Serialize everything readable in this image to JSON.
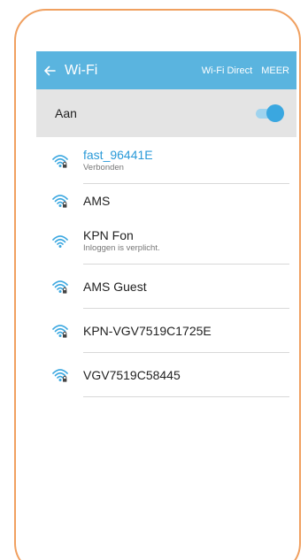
{
  "appbar": {
    "title": "Wi-Fi",
    "action_wifi_direct": "Wi-Fi Direct",
    "action_more": "MEER",
    "color": "#5ab4df"
  },
  "toggle": {
    "label": "Aan",
    "state": "on"
  },
  "networks": [
    {
      "name": "fast_96441E",
      "status": "Verbonden",
      "locked": true,
      "connected": true,
      "icon": "wifi-lock-icon"
    },
    {
      "name": "AMS",
      "status": "",
      "locked": true,
      "connected": false,
      "icon": "wifi-lock-icon"
    },
    {
      "name": "KPN Fon",
      "status": "Inloggen is verplicht.",
      "locked": false,
      "connected": false,
      "icon": "wifi-icon"
    },
    {
      "name": "AMS Guest",
      "status": "",
      "locked": true,
      "connected": false,
      "icon": "wifi-lock-icon"
    },
    {
      "name": "KPN-VGV7519C1725E",
      "status": "",
      "locked": true,
      "connected": false,
      "icon": "wifi-lock-icon"
    },
    {
      "name": "VGV7519C58445",
      "status": "",
      "locked": true,
      "connected": false,
      "icon": "wifi-lock-icon"
    }
  ],
  "colors": {
    "accent": "#2a9ad8",
    "frame": "#f0a060",
    "toggle_on": "#3aa7e0"
  }
}
